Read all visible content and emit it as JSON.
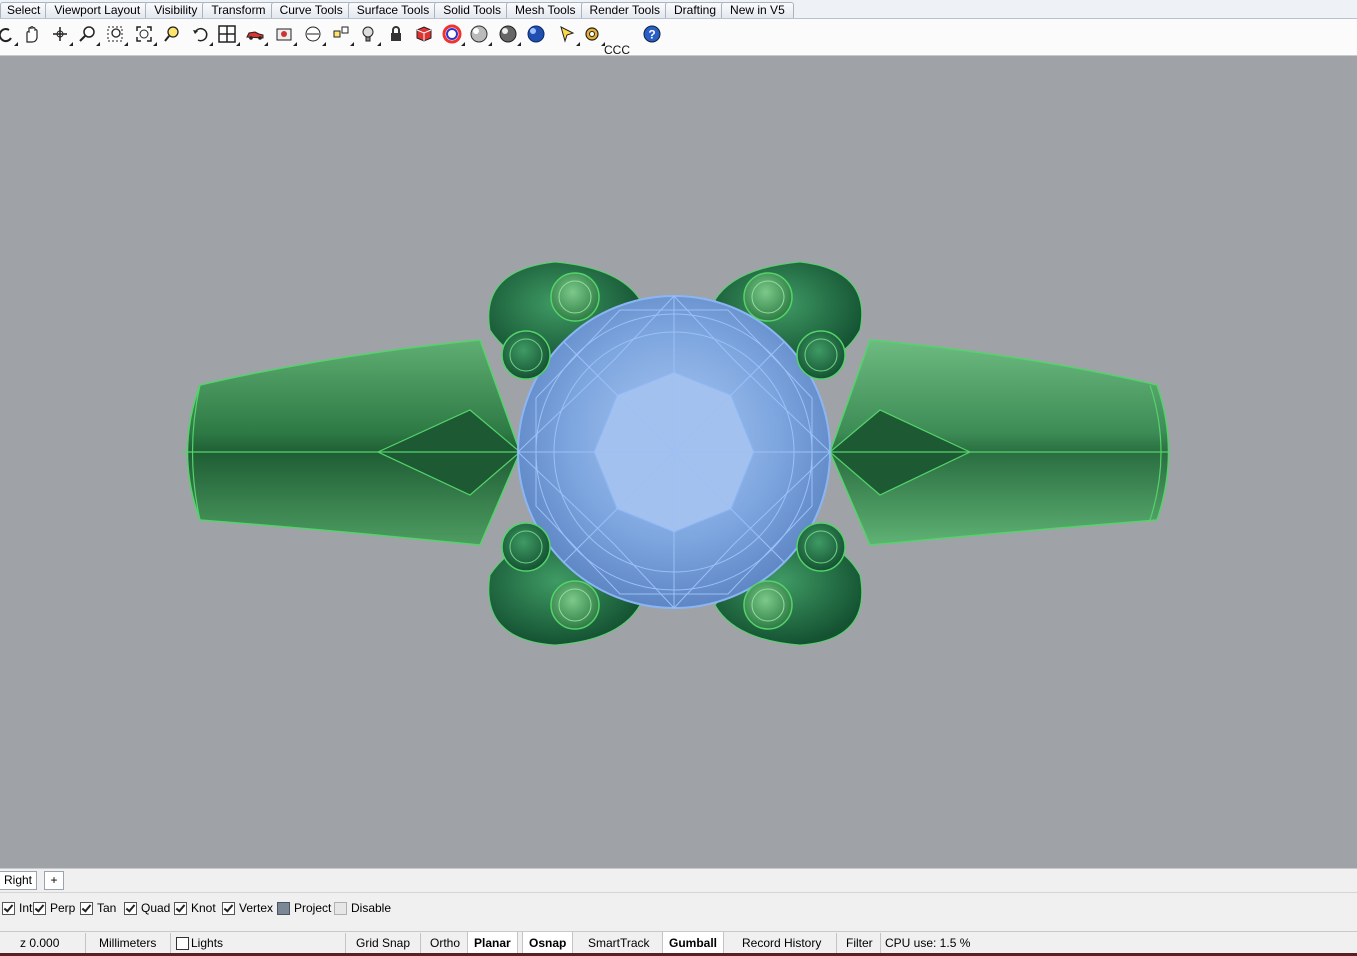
{
  "menu_tabs": [
    "Select",
    "Viewport Layout",
    "Visibility",
    "Transform",
    "Curve Tools",
    "Surface Tools",
    "Solid Tools",
    "Mesh Tools",
    "Render Tools",
    "Drafting",
    "New in V5"
  ],
  "toolbar": {
    "icons": [
      "undo-icon",
      "pan-hand-icon",
      "rotate-view-icon",
      "zoom-icon",
      "zoom-window-icon",
      "zoom-extents-icon",
      "zoom-selected-icon",
      "undo-view-icon",
      "four-viewports-icon",
      "render-car-icon",
      "named-views-icon",
      "set-cplane-icon",
      "point-icon",
      "light-bulb-icon",
      "lock-icon",
      "shaded-box-icon",
      "color-wheel-icon",
      "shaded-sphere-icon",
      "rendered-sphere-icon",
      "blue-sphere-icon",
      "pointer-icon",
      "gear-settings-icon",
      "help-icon"
    ],
    "ccc_label": "CCC"
  },
  "viewport_tabs": {
    "active": "Right",
    "add_label": "+"
  },
  "osnaps": [
    {
      "label": "Int",
      "state": "checked"
    },
    {
      "label": "Perp",
      "state": "checked"
    },
    {
      "label": "Tan",
      "state": "checked"
    },
    {
      "label": "Quad",
      "state": "checked"
    },
    {
      "label": "Knot",
      "state": "checked"
    },
    {
      "label": "Vertex",
      "state": "checked"
    },
    {
      "label": "Project",
      "state": "filled"
    },
    {
      "label": "Disable",
      "state": "off"
    }
  ],
  "status": {
    "coord": "z 0.000",
    "units": "Millimeters",
    "layer": "Lights",
    "grid_snap": "Grid Snap",
    "ortho": "Ortho",
    "planar": "Planar",
    "osnap": "Osnap",
    "smarttrack": "SmartTrack",
    "gumball": "Gumball",
    "record_history": "Record History",
    "filter": "Filter",
    "cpu": "CPU use: 1.5 %"
  },
  "colors": {
    "viewport_bg": "#9fa3a8",
    "ring_green": "#2f8a52",
    "gem_blue": "#7aa6e6"
  }
}
